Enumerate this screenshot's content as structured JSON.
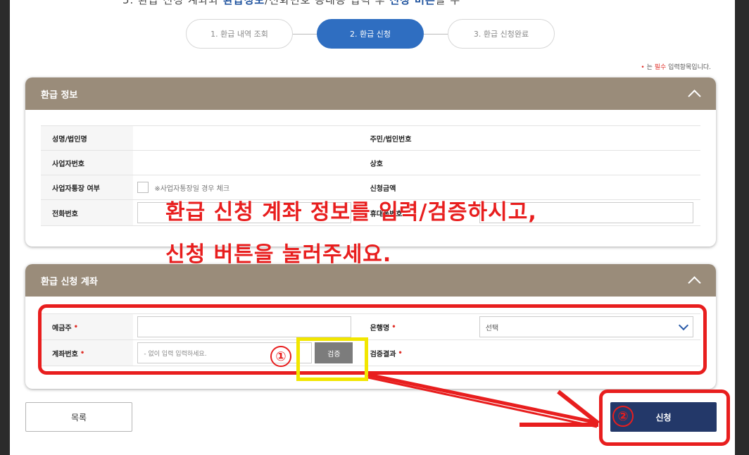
{
  "header": {
    "cut_text_pre": "5. 환급 신청 계좌와 ",
    "cut_text_hl1": "환급정보",
    "cut_text_mid": "/전화번호 등내용 입력 후 ",
    "cut_text_hl2": "신청 버튼",
    "cut_text_post": "을 누"
  },
  "steps": [
    {
      "label": "1. 환급 내역 조회",
      "active": false
    },
    {
      "label": "2. 환급 신청",
      "active": true
    },
    {
      "label": "3. 환급 신청완료",
      "active": false
    }
  ],
  "required_note": {
    "dot": "•",
    "pre": "는 ",
    "red": "필수",
    "post": " 입력항목입니다."
  },
  "refund_info": {
    "title": "환급 정보",
    "rows": [
      {
        "l1": "성명/법인명",
        "l2": "주민/법인번호"
      },
      {
        "l1": "사업자번호",
        "l2": "상호"
      },
      {
        "l1": "사업자통장 여부",
        "checkbox_note": "※사업자통장일 경우 체크",
        "l2": "신청금액"
      },
      {
        "l1": "전화번호",
        "l2": "휴대폰번호"
      }
    ]
  },
  "account": {
    "title": "환급 신청 계좌",
    "holder_label": "예금주",
    "bank_label": "은행명",
    "bank_value": "선택",
    "account_label": "계좌번호",
    "account_placeholder": "- 없이 입력 입력하세요.",
    "verify_button": "검증",
    "result_label": "검증결과",
    "required_mark": "•"
  },
  "buttons": {
    "list": "목록",
    "apply": "신청"
  },
  "annotation": {
    "line1": "환급 신청 계좌 정보를 입력/검증하시고,",
    "line2": "신청 버튼을 눌러주세요.",
    "num1": "①",
    "num2": "②",
    "color": "#e81e1e",
    "highlight_color": "#f2e600"
  }
}
